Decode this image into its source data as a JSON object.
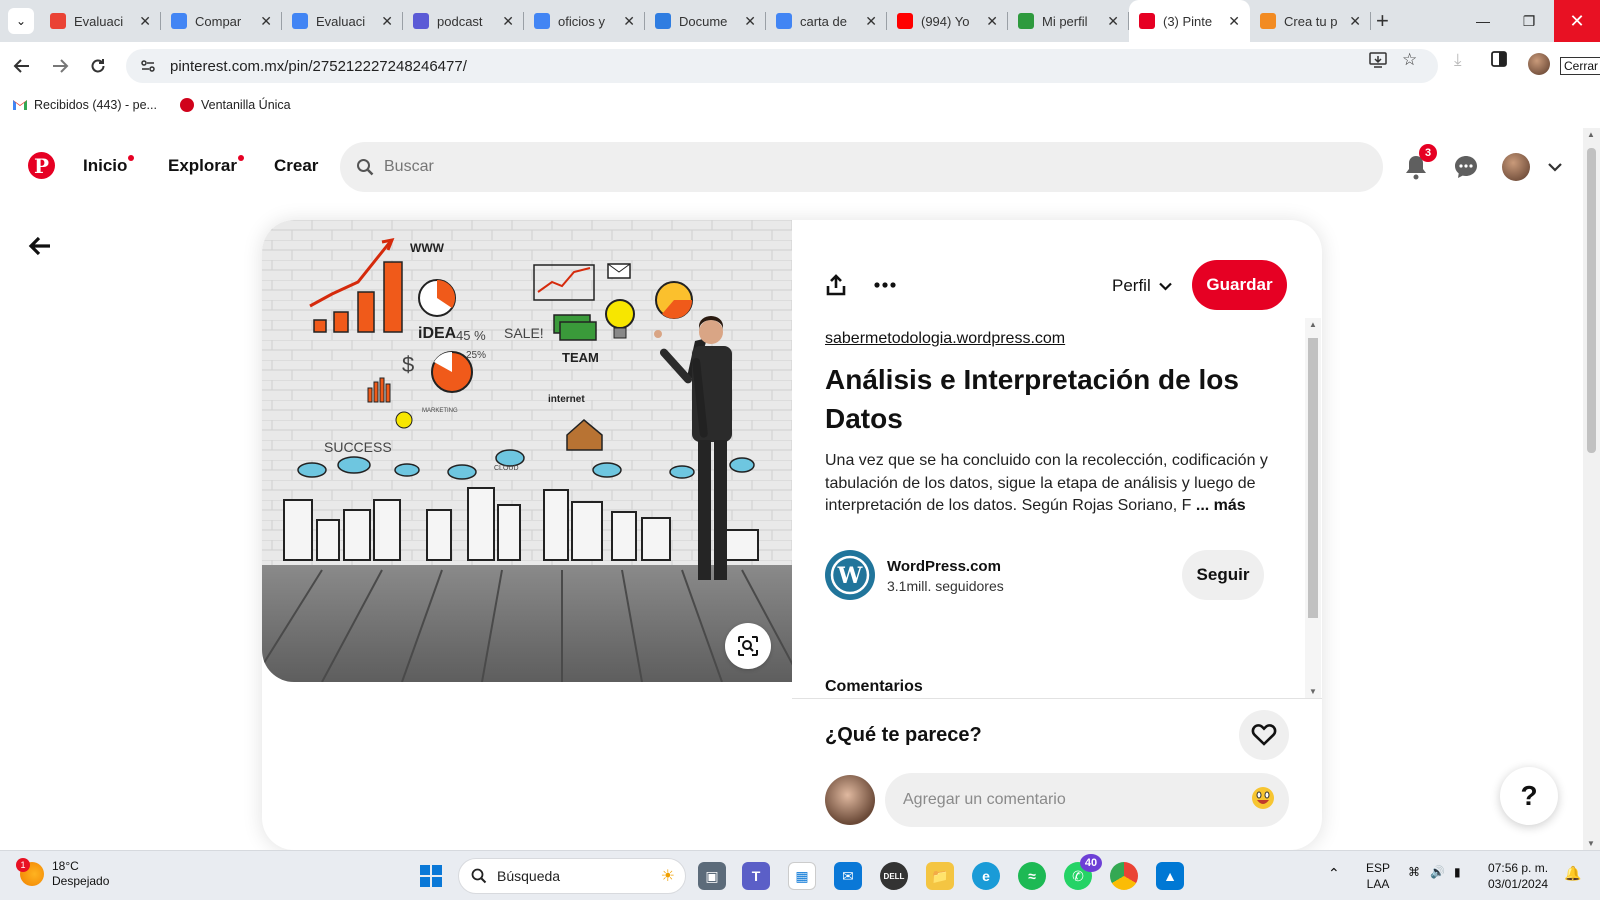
{
  "browser": {
    "tabs": [
      {
        "title": "Evaluaci",
        "favicon": "gmail-icon",
        "color": "#ea4335",
        "active": false
      },
      {
        "title": "Compar",
        "favicon": "docs-icon",
        "color": "#4285f4",
        "active": false
      },
      {
        "title": "Evaluaci",
        "favicon": "docs-icon",
        "color": "#4285f4",
        "active": false
      },
      {
        "title": "podcast",
        "favicon": "podcast-icon",
        "color": "#5b5bd6",
        "active": false
      },
      {
        "title": "oficios y",
        "favicon": "google-icon",
        "color": "#4285f4",
        "active": false
      },
      {
        "title": "Docume",
        "favicon": "docs-icon",
        "color": "#2f7de1",
        "active": false
      },
      {
        "title": "carta de",
        "favicon": "google-icon",
        "color": "#4285f4",
        "active": false
      },
      {
        "title": "(994) Yo",
        "favicon": "youtube-icon",
        "color": "#ff0000",
        "active": false
      },
      {
        "title": "Mi perfil",
        "favicon": "profile-icon",
        "color": "#2e9a3e",
        "active": false
      },
      {
        "title": "(3) Pinte",
        "favicon": "pinterest-icon",
        "color": "#e60023",
        "active": true
      },
      {
        "title": "Crea tu p",
        "favicon": "create-icon",
        "color": "#f28b22",
        "active": false
      }
    ],
    "url": "pinterest.com.mx/pin/275212227248246477/",
    "profile_chip": "Cerrar",
    "bookmarks": [
      {
        "label": "Recibidos (443) - pe...",
        "icon": "gmail-icon"
      },
      {
        "label": "Ventanilla Única",
        "icon": "red-circle-icon"
      }
    ]
  },
  "pinterest": {
    "nav": {
      "home": "Inicio",
      "explore": "Explorar",
      "create": "Crear"
    },
    "search_placeholder": "Buscar",
    "notification_count": "3",
    "brand_color": "#e60023"
  },
  "pin": {
    "source": "sabermetodologia.wordpress.com",
    "title": "Análisis e Interpretación de los Datos",
    "description": "Una vez que se ha concluido con la recolección, codificación y tabulación de los datos, sigue la etapa de análisis y luego de interpretación de los datos. Según Rojas Soriano, F",
    "more_label": "... más",
    "profile_label": "Perfil",
    "save_label": "Guardar",
    "creator": {
      "name": "WordPress.com",
      "followers": "3.1mill. seguidores",
      "follow_label": "Seguir"
    },
    "comments_heading": "Comentarios",
    "reaction_prompt": "¿Qué te parece?",
    "comment_placeholder": "Agregar un comentario",
    "image_texts": {
      "www": "WWW",
      "idea": "iDEA",
      "pct": "45 %",
      "sale": "SALE!",
      "team": "TEAM",
      "internet": "internet",
      "success": "SUCCESS",
      "cloud": "CLOUD",
      "pct2": "25%",
      "marketing": "MARKETING"
    }
  },
  "help_label": "?",
  "taskbar": {
    "weather_temp": "18°C",
    "weather_desc": "Despejado",
    "weather_badge": "1",
    "search_label": "Búsqueda",
    "whatsapp_badge": "40",
    "lang_top": "ESP",
    "lang_bottom": "LAA",
    "time": "07:56 p. m.",
    "date": "03/01/2024"
  }
}
